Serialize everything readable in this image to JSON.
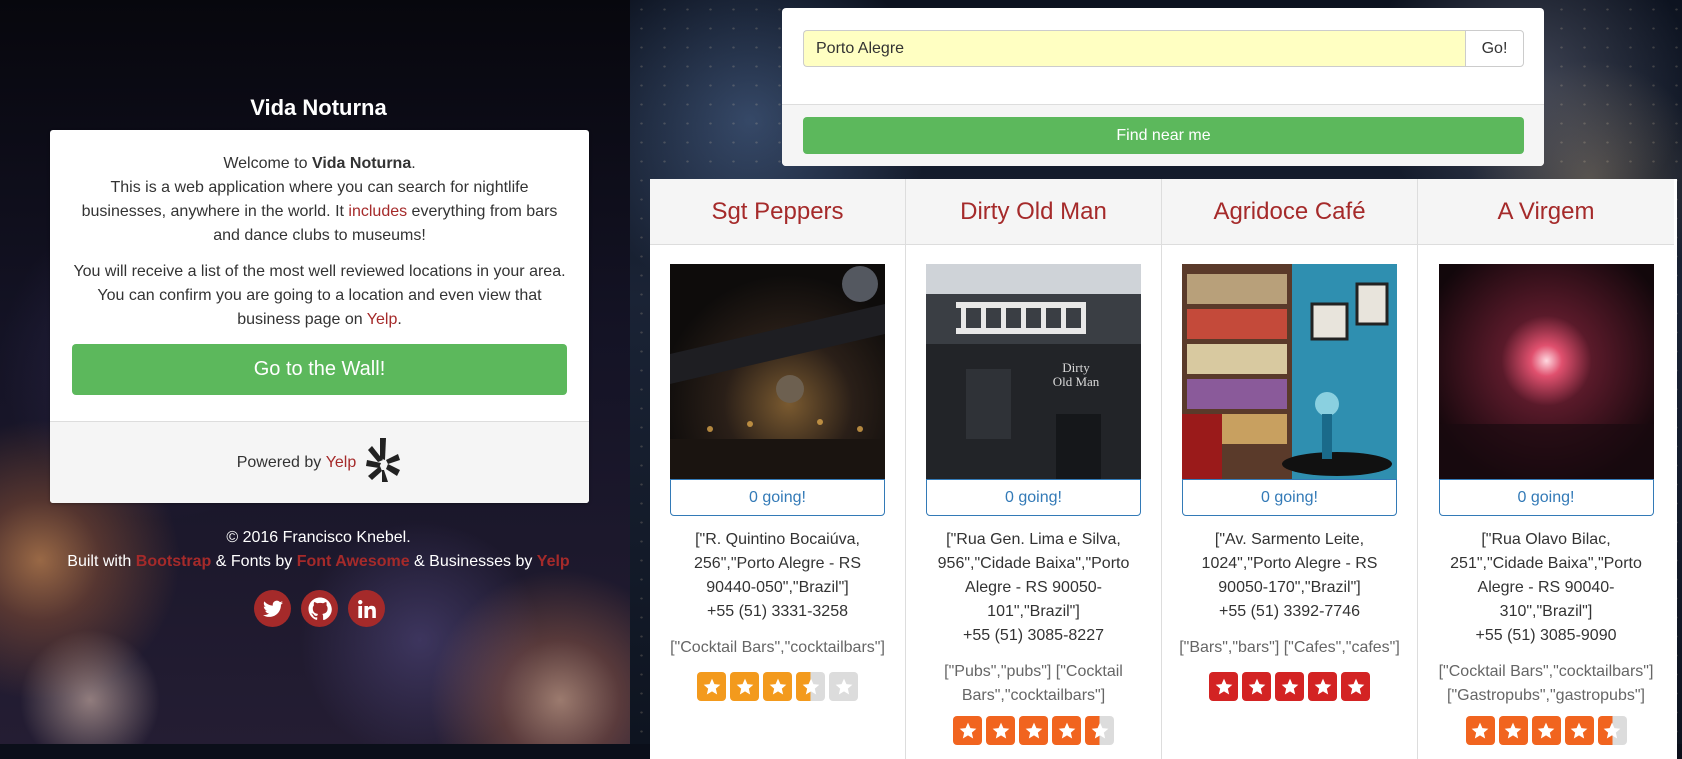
{
  "site": {
    "title": "Vida Noturna",
    "welcome_prefix": "Welcome to ",
    "welcome_brand": "Vida Noturna",
    "welcome_suffix": ".",
    "intro_1": "This is a web application where you can search for nightlife businesses, anywhere in the world. It ",
    "intro_link": "includes",
    "intro_2": " everything from bars and dance clubs to museums!",
    "list_text": "You will receive a list of the most well reviewed locations in your area. You can confirm you are going to a location and even view that business page on ",
    "list_link": "Yelp",
    "list_end": ".",
    "wall_button": "Go to the Wall!",
    "powered_prefix": "Powered by ",
    "powered_link": "Yelp"
  },
  "credits": {
    "copyright": "© 2016 Francisco Knebel.",
    "built_with": "Built with ",
    "bootstrap": "Bootstrap",
    "fonts_by": " & Fonts by ",
    "font_awesome": "Font Awesome",
    "businesses_by": " & Businesses by ",
    "yelp": "Yelp"
  },
  "socials": [
    {
      "icon": "twitter-icon"
    },
    {
      "icon": "github-icon"
    },
    {
      "icon": "linkedin-icon"
    }
  ],
  "search": {
    "value": "Porto Alegre",
    "go_label": "Go!",
    "near_label": "Find near me"
  },
  "businesses": [
    {
      "name": "Sgt Peppers",
      "going": "0 going!",
      "address": "[\"R. Quintino Bocaiúva, 256\",\"Porto Alegre - RS 90440-050\",\"Brazil\"]",
      "phone": "+55 (51) 3331-3258",
      "categories": "[\"Cocktail Bars\",\"cocktailbars\"]",
      "rating": 3.5,
      "star_color": "#f39a1d"
    },
    {
      "name": "Dirty Old Man",
      "going": "0 going!",
      "address": "[\"Rua Gen. Lima e Silva, 956\",\"Cidade Baixa\",\"Porto Alegre - RS 90050-101\",\"Brazil\"]",
      "phone": "+55 (51) 3085-8227",
      "categories": "[\"Pubs\",\"pubs\"] [\"Cocktail Bars\",\"cocktailbars\"]",
      "rating": 4.5,
      "star_color": "#f1641f"
    },
    {
      "name": "Agridoce Café",
      "going": "0 going!",
      "address": "[\"Av. Sarmento Leite, 1024\",\"Porto Alegre - RS 90050-170\",\"Brazil\"]",
      "phone": "+55 (51) 3392-7746",
      "categories": "[\"Bars\",\"bars\"] [\"Cafes\",\"cafes\"]",
      "rating": 5,
      "star_color": "#d32323"
    },
    {
      "name": "A Virgem",
      "going": "0 going!",
      "address": "[\"Rua Olavo Bilac, 251\",\"Cidade Baixa\",\"Porto Alegre - RS 90040-310\",\"Brazil\"]",
      "phone": "+55 (51) 3085-9090",
      "categories": "[\"Cocktail Bars\",\"cocktailbars\"] [\"Gastropubs\",\"gastropubs\"]",
      "rating": 4.5,
      "star_color": "#f1641f"
    }
  ],
  "colors": {
    "accent_red": "#a52a2a",
    "success_green": "#5cb85c",
    "link_blue": "#337ab7",
    "input_yellow": "#ffffc2"
  }
}
